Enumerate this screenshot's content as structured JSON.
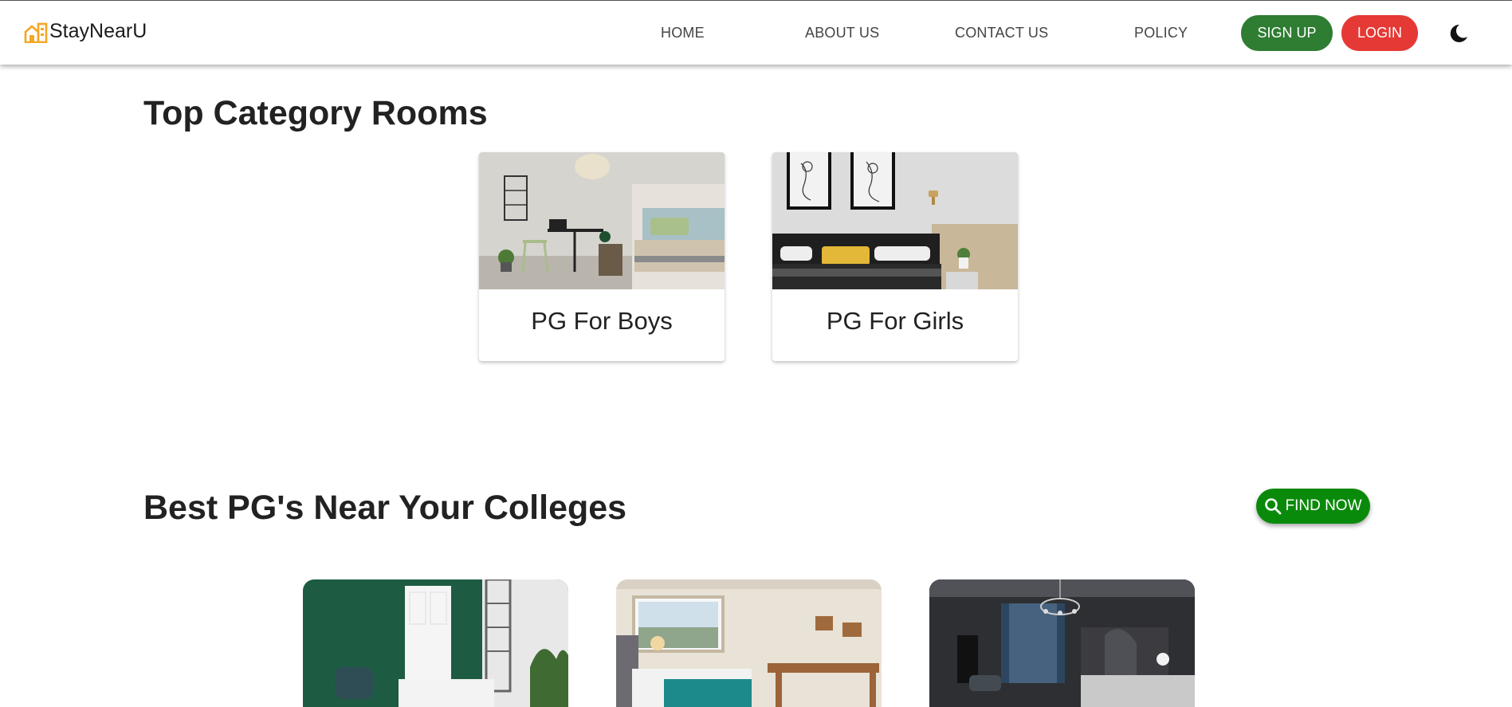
{
  "header": {
    "brand": "StayNearU",
    "nav": [
      "HOME",
      "ABOUT US",
      "CONTACT US",
      "POLICY"
    ],
    "signup_label": "SIGN UP",
    "login_label": "LOGIN"
  },
  "top_category": {
    "title": "Top Category Rooms",
    "cards": [
      {
        "label": "PG For Boys"
      },
      {
        "label": "PG For Girls"
      }
    ]
  },
  "best_pgs": {
    "title": "Best PG's Near Your Colleges",
    "find_label": "FIND NOW"
  },
  "colors": {
    "signup": "#2e7d32",
    "login": "#e53935",
    "find": "#0a8a0a",
    "logo": "#f5a623"
  }
}
